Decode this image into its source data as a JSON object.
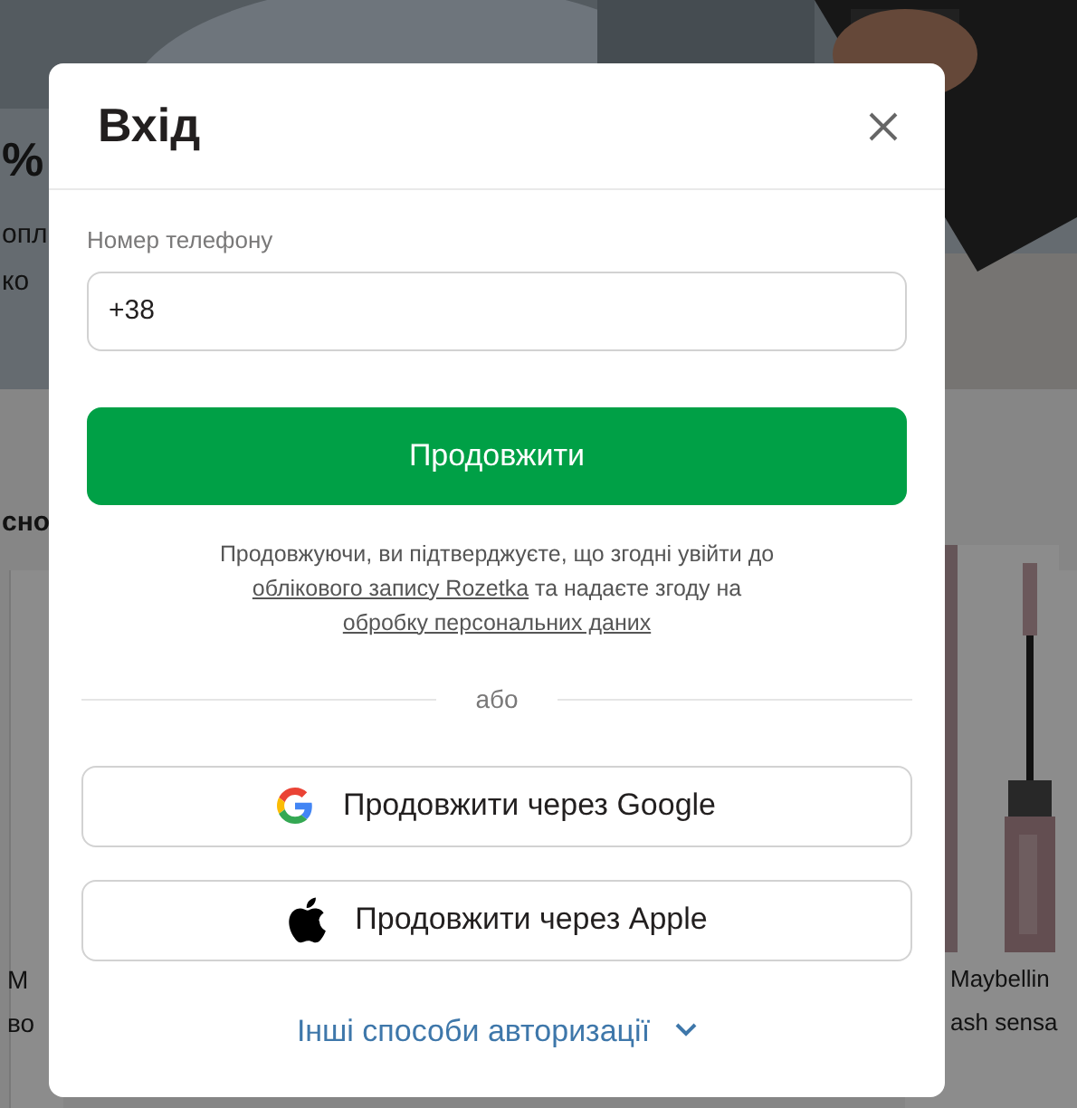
{
  "background": {
    "banner_fragments": [
      "%",
      "опл",
      "ко"
    ],
    "section_fragment": "сно",
    "product_left": [
      "М",
      "во"
    ],
    "product_right": [
      "Maybellin",
      "ash sensa"
    ]
  },
  "dialog": {
    "title": "Вхід",
    "phone": {
      "label": "Номер телефону",
      "value": "+38"
    },
    "continue_button": "Продовжити",
    "consent": [
      {
        "kind": "text",
        "text": "Продовжуючи, ви підтверджуєте, що згодні увійти до "
      },
      {
        "kind": "link",
        "text": "облікового запису Rozetka"
      },
      {
        "kind": "text",
        "text": " та надаєте згоду на "
      },
      {
        "kind": "link",
        "text": "обробку персональних даних"
      }
    ],
    "divider": "або",
    "social_buttons": [
      {
        "kind": "google",
        "label": "Продовжити через Google"
      },
      {
        "kind": "apple",
        "label": "Продовжити через Apple"
      }
    ],
    "more_link": {
      "label": "Інші способи авторизації",
      "expanded": false
    }
  }
}
